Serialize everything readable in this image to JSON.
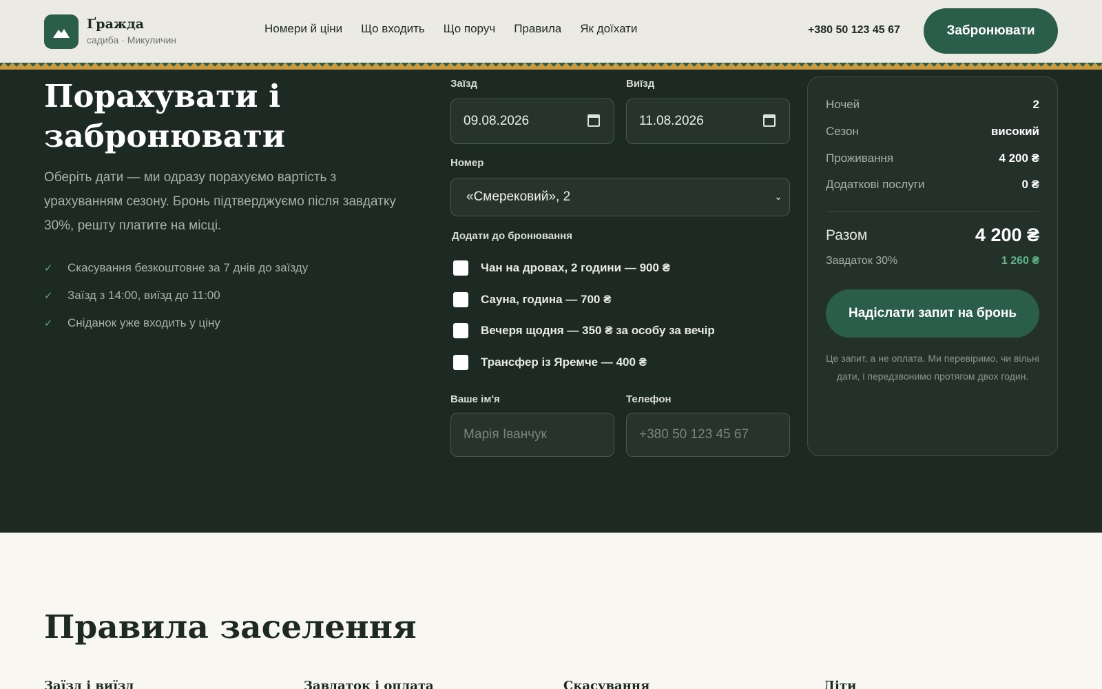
{
  "header": {
    "brand_name": "Ґражда",
    "brand_sub": "садиба · Микуличин",
    "nav": [
      "Номери й ціни",
      "Що входить",
      "Що поруч",
      "Правила",
      "Як доїхати"
    ],
    "phone": "+380 50 123 45 67",
    "book_label": "Забронювати"
  },
  "booking": {
    "title": "Порахувати і забронювати",
    "lead": "Оберіть дати — ми одразу порахуємо вартість з урахуванням сезону. Бронь підтверджуємо після завдатку 30%, решту платите на місці.",
    "checklist": [
      "Скасування безкоштовне за 7 днів до заїзду",
      "Заїзд з 14:00, виїзд до 11:00",
      "Сніданок уже входить у ціну"
    ],
    "checkin_label": "Заїзд",
    "checkin_value": "09.08.2026",
    "checkout_label": "Виїзд",
    "checkout_value": "11.08.2026",
    "room_label": "Номер",
    "room_value": "«Смерековий», 2",
    "extras_label": "Додати до бронювання",
    "extras": [
      "Чан на дровах, 2 години — 900 ₴",
      "Сауна, година — 700 ₴",
      "Вечеря щодня — 350 ₴ за особу за вечір",
      "Трансфер із Яремче — 400 ₴"
    ],
    "name_label": "Ваше ім'я",
    "name_placeholder": "Марія Іванчук",
    "phone_label": "Телефон",
    "phone_placeholder": "+380 50 123 45 67"
  },
  "summary": {
    "nights_label": "Ночей",
    "nights_value": "2",
    "season_label": "Сезон",
    "season_value": "високий",
    "stay_label": "Проживання",
    "stay_value": "4 200 ₴",
    "extras_label": "Додаткові послуги",
    "extras_value": "0 ₴",
    "total_label": "Разом",
    "total_value": "4 200 ₴",
    "deposit_label": "Завдаток 30%",
    "deposit_value": "1 260 ₴",
    "send_label": "Надіслати запит на бронь",
    "note": "Це запит, а не оплата. Ми перевіримо, чи вільні дати, і передзвонимо протягом двох годин."
  },
  "rules": {
    "title": "Правила заселення",
    "columns": [
      "Заїзд і виїзд",
      "Завдаток і оплата",
      "Скасування",
      "Діти"
    ]
  },
  "colors": {
    "brand_green": "#2b5e4a",
    "dark_bg": "#1c2a23",
    "accent_green": "#5cb885",
    "ornament_gold": "#c99a3e"
  }
}
